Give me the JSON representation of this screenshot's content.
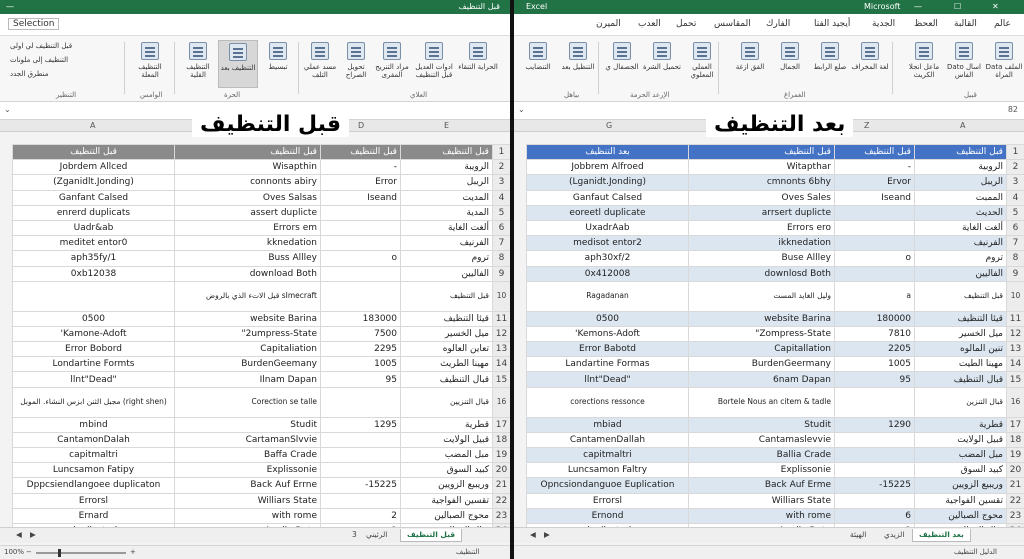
{
  "left": {
    "title": "قبل التنظيف",
    "banner": "قبل التنظيف",
    "tab_label": "Selection",
    "ribbon_small": [
      "قبل التنظيف لي اولى",
      "التنظيف إلى ملونات",
      "منطرق الجدد"
    ],
    "ribbon_buttons": [
      "التنظيف المعلة",
      "التنظيف القلية",
      "التنظيف بعد",
      "تبسيط",
      "مسد عملي التلف",
      "تحويل الصراح",
      "مراد التنريح المقرى",
      "ادوات العديل قبل التنظيف",
      "الحراية التنقاء"
    ],
    "group_labels": [
      "التنظير",
      "الوامس",
      "الحرة",
      "العلاي"
    ],
    "name_box": "",
    "col_headers": [
      "A",
      "B",
      "C",
      "D",
      "E"
    ],
    "grid_headers": [
      "قبل التنظيف",
      "قبل التنظيف",
      "قبل التنظيف",
      "قبل التنظيف"
    ],
    "sheet_tabs": [
      "قبل التنظيف",
      "الرئيني",
      "3"
    ],
    "status_left": "التنظيف",
    "zoom": "100%",
    "rows": [
      {
        "n": "2",
        "a": "Jobrdem Allced",
        "b": "Wisapthin",
        "c": "-",
        "d": "الرويبة"
      },
      {
        "n": "3",
        "a": "(Zganidlt.Jonding)",
        "b": "connonts abiry",
        "c": "Error",
        "d": "الريبل"
      },
      {
        "n": "4",
        "a": "Ganfant Calsed",
        "b": "Oves Salsas",
        "c": "Iseand",
        "d": "المديت"
      },
      {
        "n": "5",
        "a": "enrerd duplicats",
        "b": "assert duplicte",
        "c": "",
        "d": "المدية"
      },
      {
        "n": "6",
        "a": "Uadr&ab",
        "b": "Errors em",
        "c": "",
        "d": "ألغت الغاية"
      },
      {
        "n": "7",
        "a": "meditet entor0",
        "b": "kknedation",
        "c": "",
        "d": "الفرنيف"
      },
      {
        "n": "8",
        "a": "aph35fy/1",
        "b": "Buss Allley",
        "c": "o",
        "d": "تروم"
      },
      {
        "n": "9",
        "a": "0xb12038",
        "b": "download Both",
        "c": "",
        "d": "الفاليين"
      },
      {
        "n": "10",
        "a": "",
        "b": "قبل الاتء الذي بالروض sImecraft",
        "c": "",
        "d": "قبل التنظيف",
        "tall": true
      },
      {
        "n": "11",
        "a": "0500",
        "b": "website Barina",
        "c": "183000",
        "d": "قيئا التنظيف"
      },
      {
        "n": "12",
        "a": "'Kamone-Adoft",
        "b": "\"2umpress-State",
        "c": "7500",
        "d": "ميل الخسير"
      },
      {
        "n": "13",
        "a": "Error Bobord",
        "b": "Capitaliation",
        "c": "2295",
        "d": "تعاين العالوه"
      },
      {
        "n": "14",
        "a": "Londartine Formts",
        "b": "BurdenGeemany",
        "c": "1005",
        "d": "مهينا الطريث"
      },
      {
        "n": "15",
        "a": "llnt\"Dead\"",
        "b": "Ilnam Dapan",
        "c": "95",
        "d": "قبال التنظيف"
      },
      {
        "n": "16",
        "a": "مجبل الثنن ابزس النشاء. الموبل (right shen)",
        "b": "Corection se talle",
        "c": "",
        "d": "قبال التنزيين",
        "tall": true
      },
      {
        "n": "17",
        "a": "mbind",
        "b": "Studit",
        "c": "1295",
        "d": "قطرية"
      },
      {
        "n": "18",
        "a": "CantamonDalah",
        "b": "CartamanSlvvie",
        "c": "",
        "d": "قبيل الولايت"
      },
      {
        "n": "19",
        "a": "capitmaltri",
        "b": "Baffa Crade",
        "c": "",
        "d": "مبل المضب"
      },
      {
        "n": "20",
        "a": "Luncsamon Fatipy",
        "b": "Explissonie",
        "c": "",
        "d": "كبيد السوق"
      },
      {
        "n": "21",
        "a": "Dppcsiendlangoee duplicaton",
        "b": "Back Auf Errne",
        "c": "-15225",
        "d": "وريبيع الزويين"
      },
      {
        "n": "22",
        "a": "Errorsl",
        "b": "Williars State",
        "c": "",
        "d": "تقسين الفواجية"
      },
      {
        "n": "23",
        "a": "Ernard",
        "b": "with rome",
        "c": "2",
        "d": "محوج الصبالين"
      },
      {
        "n": "24",
        "a": "duplicated",
        "b": "Applie Data",
        "c": "1",
        "d": "قبال المداليين"
      }
    ]
  },
  "right": {
    "title": "Excel",
    "app_name": "Microsoft",
    "banner": "بعد التنظيف",
    "tabs": [
      "عالم",
      "القالبة",
      "العحظ",
      "الجدية",
      "أيجيد الفتا",
      "الفارك",
      "المقاسس",
      "تحمل",
      "العدب",
      "الميرن"
    ],
    "ribbon_buttons": [
      "Data الملف المراة",
      "Dato اسال الفاس",
      "ماعل انجلا الكريث",
      "لغة المخراف",
      "صلع الرابط",
      "الجمال",
      "الفق ازغة",
      "العملي المعلوي",
      "تحميل الشرة",
      "الجصفال ي",
      "التنظيل بعد",
      "التنضايب"
    ],
    "group_labels": [
      "قبيل",
      "الغمراغ",
      "الإرعد الحرمة",
      "بياهل"
    ],
    "name_box": "82",
    "col_headers": [
      "A",
      "Z",
      "",
      "G"
    ],
    "grid_headers": [
      "بعد التنظيف",
      "قبل التنظيف",
      "قبل التنظيف",
      "قبل التنظيف"
    ],
    "sheet_tabs": [
      "بعد التنظيف",
      "الزيدي",
      "الهيئة"
    ],
    "status_left": "الدليل التنظيف",
    "rows": [
      {
        "n": "2",
        "a": "الروبية",
        "b": "-",
        "c": "Witapthar",
        "d": "Jobbrem Alfroed"
      },
      {
        "n": "3",
        "a": "الريبل",
        "b": "Ervor",
        "c": "cmnonts 6bhy",
        "d": "(Lganidt.Jonding)"
      },
      {
        "n": "4",
        "a": "الممبت",
        "b": "Iseand",
        "c": "Oves Sales",
        "d": "Ganfaut Calsed"
      },
      {
        "n": "5",
        "a": "الحديث",
        "b": "",
        "c": "arrsert duplicte",
        "d": "eoreetl duplicate"
      },
      {
        "n": "6",
        "a": "ألغت الغاية",
        "b": "",
        "c": "Errors ero",
        "d": "UxadrAab"
      },
      {
        "n": "7",
        "a": "الفرنيف",
        "b": "",
        "c": "ikknedation",
        "d": "medisot entor2"
      },
      {
        "n": "8",
        "a": "تروم",
        "b": "o",
        "c": "Buse Allley",
        "d": "aph30xf/2"
      },
      {
        "n": "9",
        "a": "الفاليين",
        "b": "",
        "c": "downlosd Both",
        "d": "0x412008"
      },
      {
        "n": "10",
        "a": "قبل التنظيف",
        "b": "a",
        "c": "وليل الغايد المست",
        "d": "Ragadanan",
        "tall": true
      },
      {
        "n": "11",
        "a": "قيئا التنظيف",
        "b": "180000",
        "c": "website Barina",
        "d": "0500"
      },
      {
        "n": "12",
        "a": "ميل الخسير",
        "b": "7810",
        "c": "\"Zompress-State",
        "d": "'Kemons-Adoft"
      },
      {
        "n": "13",
        "a": "تنين المالوه",
        "b": "2205",
        "c": "Capitallation",
        "d": "Error Babotd"
      },
      {
        "n": "14",
        "a": "مهينا الطيت",
        "b": "1005",
        "c": "BurdenGeermany",
        "d": "Landartine Formas"
      },
      {
        "n": "15",
        "a": "قبال التنظيف",
        "b": "95",
        "c": "6nam Dapan",
        "d": "llnt\"Dead\""
      },
      {
        "n": "16",
        "a": "قبال التنزين",
        "b": "",
        "c": "Bortele Nous an citem & tadle",
        "d": "corections ressonce",
        "tall": true
      },
      {
        "n": "17",
        "a": "قطرية",
        "b": "1290",
        "c": "Studit",
        "d": "mbiad"
      },
      {
        "n": "18",
        "a": "قبيل الولايت",
        "b": "",
        "c": "Cantamaslevvie",
        "d": "CantamenDallah"
      },
      {
        "n": "19",
        "a": "مبل المضب",
        "b": "",
        "c": "Ballia Crade",
        "d": "capitmaltri"
      },
      {
        "n": "20",
        "a": "كبيد السوق",
        "b": "",
        "c": "Explissonie",
        "d": "Luncsamon Faltry"
      },
      {
        "n": "21",
        "a": "وريبيع الزويين",
        "b": "-15225",
        "c": "Back Auf Erme",
        "d": "Opncsiondanguoe Euplication"
      },
      {
        "n": "22",
        "a": "تقسين الفواجية",
        "b": "",
        "c": "Williars State",
        "d": "Errorsl"
      },
      {
        "n": "23",
        "a": "محوج الصبالين",
        "b": "6",
        "c": "with rome",
        "d": "Ernond"
      },
      {
        "n": "24",
        "a": "قبال المداليين",
        "b": "1",
        "c": "Applie Data",
        "d": "duplicated"
      }
    ]
  }
}
